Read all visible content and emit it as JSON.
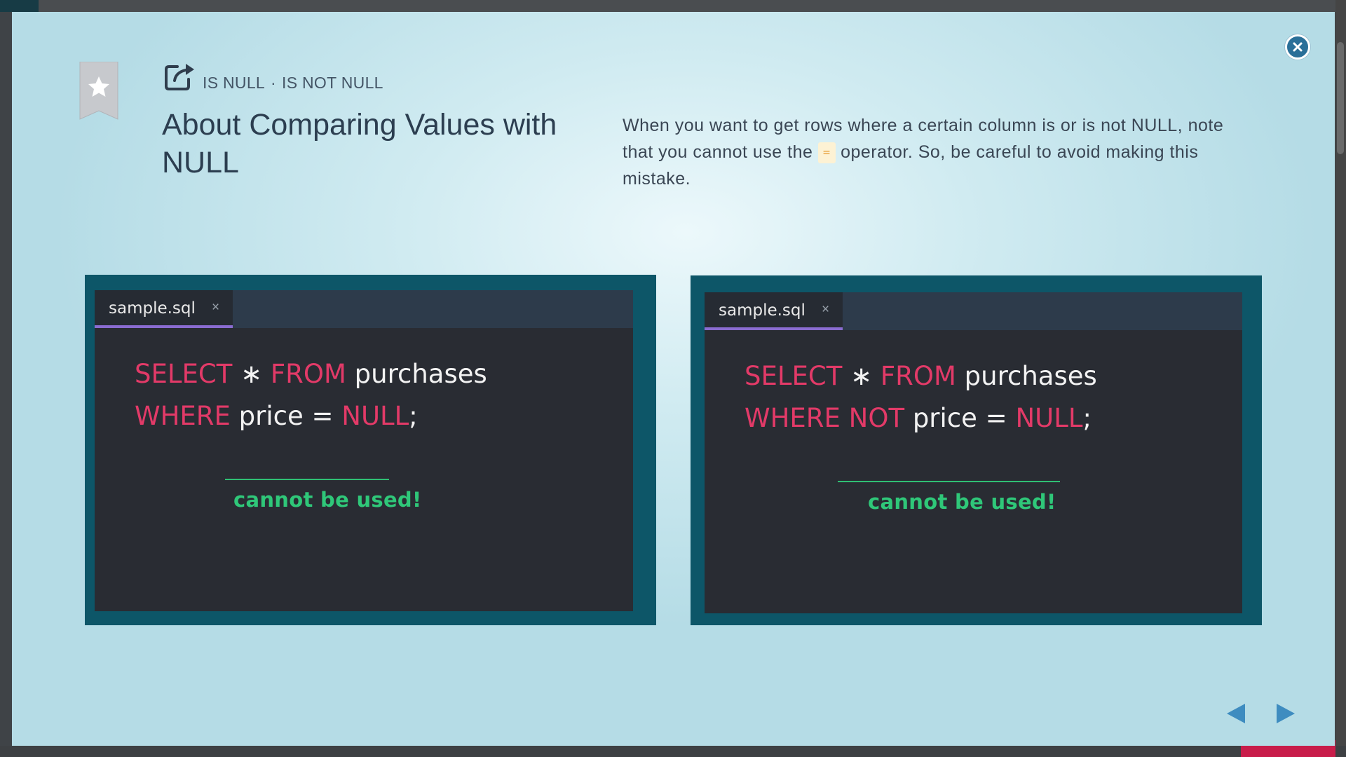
{
  "slide": {
    "subtitle": {
      "part1": "IS NULL",
      "separator": "·",
      "part2": "IS NOT NULL"
    },
    "title": "About Comparing Values with NULL",
    "description": {
      "before": "When you want to get rows where a certain column is or is not NULL, note that you cannot use the",
      "operator": "=",
      "after": "operator. So, be careful to avoid making this mistake."
    }
  },
  "panels": [
    {
      "tab_name": "sample.sql",
      "tab_close": "×",
      "line1": {
        "kw1": "SELECT",
        "star": "∗",
        "kw2": "FROM",
        "table": "purchases"
      },
      "line2": {
        "kw1": "WHERE",
        "not": "",
        "column": "price",
        "op": "=",
        "kw3": "NULL",
        "end": ";"
      },
      "note": "cannot be used!"
    },
    {
      "tab_name": "sample.sql",
      "tab_close": "×",
      "line1": {
        "kw1": "SELECT",
        "star": "∗",
        "kw2": "FROM",
        "table": "purchases"
      },
      "line2": {
        "kw1": "WHERE",
        "not": "NOT",
        "column": "price",
        "op": "=",
        "kw3": "NULL",
        "end": ";"
      },
      "note": "cannot be used!"
    }
  ],
  "colors": {
    "keyword": "#e23a68",
    "note": "#2fc779",
    "panel_frame": "#0d5668",
    "editor_bg": "#292c33",
    "tab_underline": "#8a6cd1",
    "close_button": "#2a6f98",
    "nav_arrow": "#3e8cc0"
  },
  "icons": {
    "bookmark": "star-bookmark-icon",
    "external": "external-link-icon",
    "close": "close-icon",
    "prev": "prev-arrow-icon",
    "next": "next-arrow-icon"
  }
}
